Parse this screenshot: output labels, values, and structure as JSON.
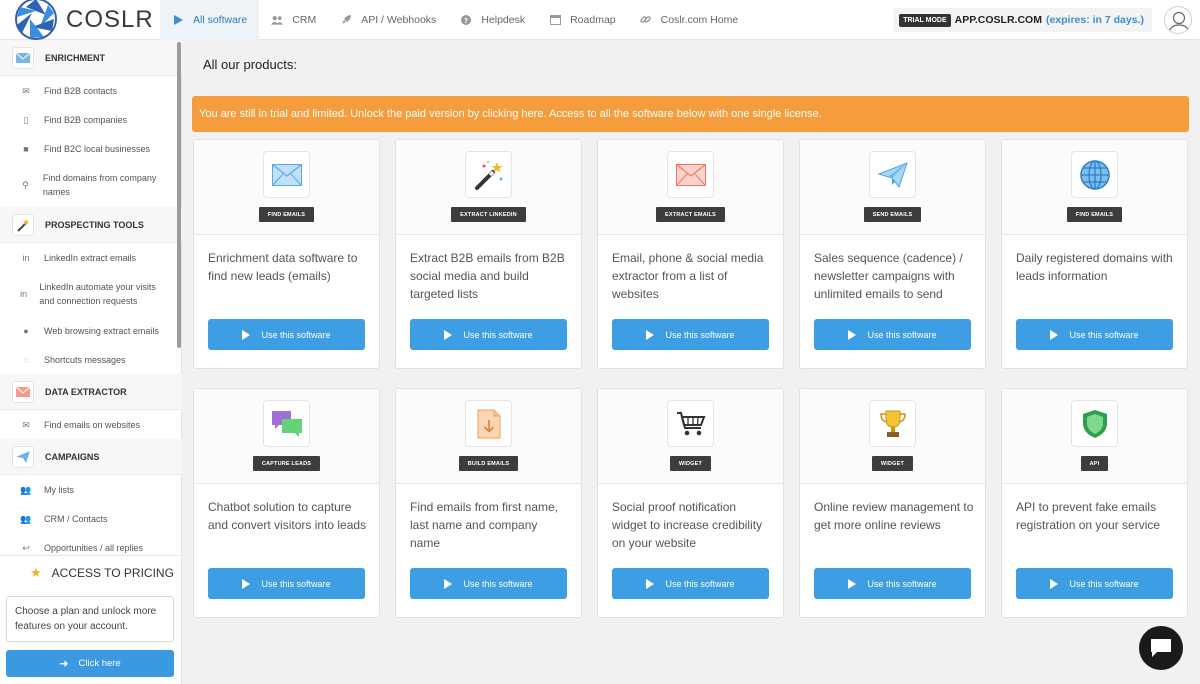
{
  "brand": {
    "name": "COSLR"
  },
  "nav": [
    {
      "label": "All software",
      "icon": "play-icon"
    },
    {
      "label": "CRM",
      "icon": "users-icon"
    },
    {
      "label": "API / Webhooks",
      "icon": "rocket-icon"
    },
    {
      "label": "Helpdesk",
      "icon": "question-icon"
    },
    {
      "label": "Roadmap",
      "icon": "calendar-icon"
    },
    {
      "label": "Coslr.com Home",
      "icon": "link-icon"
    }
  ],
  "trial": {
    "badge": "TRIAL MODE",
    "domain": "APP.COSLR.COM",
    "expires": "(expires: in 7 days.)"
  },
  "sidebar": {
    "sections": [
      {
        "title": "ENRICHMENT",
        "items": [
          "Find B2B contacts",
          "Find B2B companies",
          "Find B2C local businesses",
          "Find domains from company names"
        ]
      },
      {
        "title": "PROSPECTING TOOLS",
        "items": [
          "LinkedIn extract emails",
          "LinkedIn automate your visits and connection requests",
          "Web browsing extract emails",
          "Shortcuts messages"
        ]
      },
      {
        "title": "DATA EXTRACTOR",
        "items": [
          "Find emails on websites"
        ]
      },
      {
        "title": "CAMPAIGNS",
        "items": [
          "My lists",
          "CRM / Contacts",
          "Opportunities / all replies"
        ]
      }
    ],
    "pricing_label": "ACCESS TO PRICING",
    "plan_text": "Choose a plan and unlock more features on your account.",
    "click_label": "Click here"
  },
  "main": {
    "title": "All our products:",
    "alert": "You are still in trial and limited. Unlock the paid version by clicking here. Access to all the software below with one single license.",
    "button_label": "Use this software",
    "cards": [
      {
        "badge": "FIND EMAILS",
        "desc": "Enrichment data software to find new leads (emails)",
        "icon": "envelope-blue-icon"
      },
      {
        "badge": "EXTRACT LINKEDIN",
        "desc": "Extract B2B emails from B2B social media and build targeted lists",
        "icon": "magic-wand-icon"
      },
      {
        "badge": "EXTRACT EMAILS",
        "desc": "Email, phone & social media extractor from a list of websites",
        "icon": "envelope-red-icon"
      },
      {
        "badge": "SEND EMAILS",
        "desc": "Sales sequence (cadence) / newsletter campaigns with unlimited emails to send",
        "icon": "paper-plane-icon"
      },
      {
        "badge": "FIND EMAILS",
        "desc": "Daily registered domains with leads information",
        "icon": "globe-icon"
      },
      {
        "badge": "CAPTURE LEADS",
        "desc": "Chatbot solution to capture and convert visitors into leads",
        "icon": "chat-bubbles-icon"
      },
      {
        "badge": "BUILD EMAILS",
        "desc": "Find emails from first name, last name and company name",
        "icon": "download-file-icon"
      },
      {
        "badge": "WIDGET",
        "desc": "Social proof notification widget to increase credibility on your website",
        "icon": "shopping-cart-icon"
      },
      {
        "badge": "WIDGET",
        "desc": "Online review management to get more online reviews",
        "icon": "trophy-icon"
      },
      {
        "badge": "API",
        "desc": "API to prevent fake emails registration on your service",
        "icon": "shield-icon"
      }
    ]
  }
}
